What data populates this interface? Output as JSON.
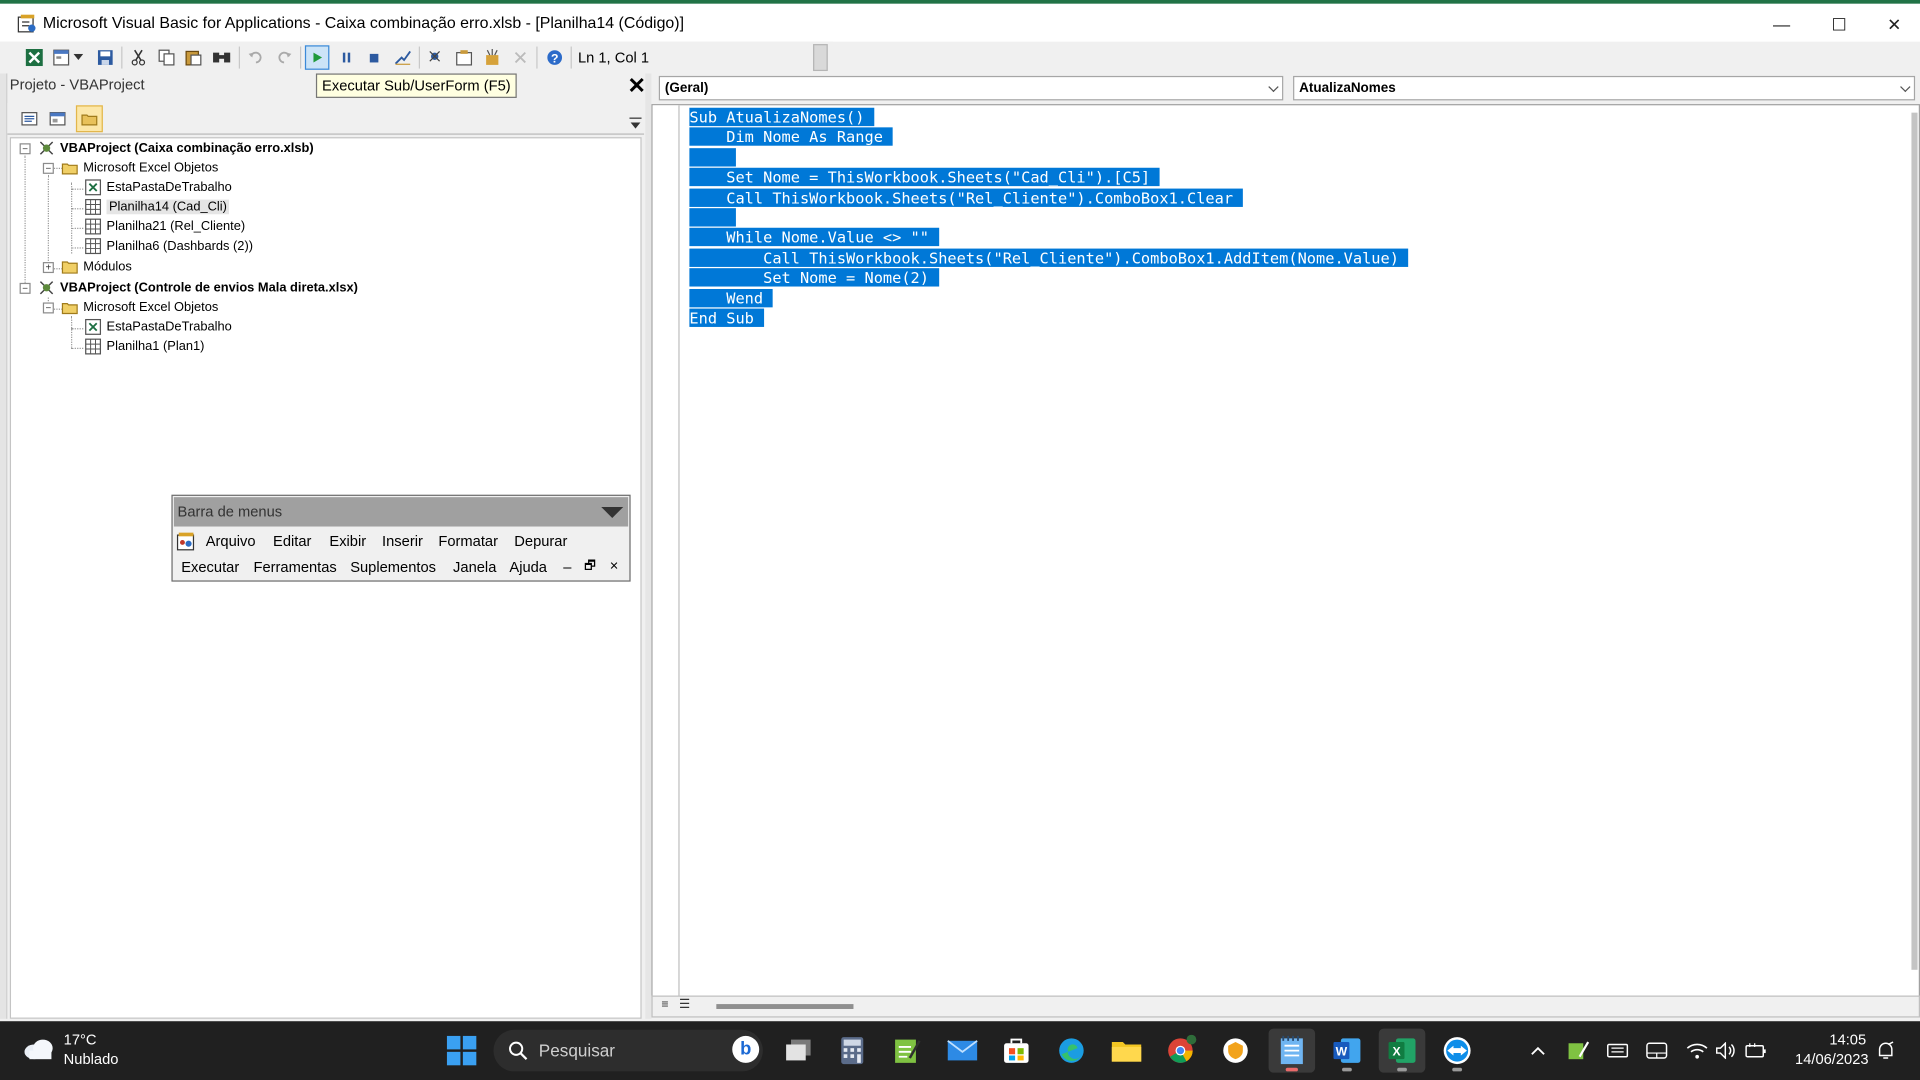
{
  "window": {
    "title": "Microsoft Visual Basic for Applications - Caixa combinação erro.xlsb - [Planilha14 (Código)]",
    "minimize": "—",
    "maximize": "☐",
    "close": "✕"
  },
  "toolbar": {
    "position": "Ln 1, Col 1",
    "tooltip": "Executar Sub/UserForm (F5)"
  },
  "project": {
    "title": "Projeto - VBAProject",
    "close": "✕",
    "tree": [
      {
        "label": "VBAProject (Caixa combinação erro.xlsb)"
      },
      {
        "label": "Microsoft Excel Objetos"
      },
      {
        "label": "EstaPastaDeTrabalho"
      },
      {
        "label": "Planilha14 (Cad_Cli)"
      },
      {
        "label": "Planilha21 (Rel_Cliente)"
      },
      {
        "label": "Planilha6 (Dashbards (2))"
      },
      {
        "label": "Módulos"
      },
      {
        "label": "VBAProject (Controle de envios Mala direta.xlsx)"
      },
      {
        "label": "Microsoft Excel Objetos"
      },
      {
        "label": "EstaPastaDeTrabalho"
      },
      {
        "label": "Planilha1 (Plan1)"
      }
    ]
  },
  "menubar": {
    "title": "Barra de menus",
    "row1": [
      "Arquivo",
      "Editar",
      "Exibir",
      "Inserir",
      "Formatar",
      "Depurar"
    ],
    "row2": [
      "Executar",
      "Ferramentas",
      "Suplementos",
      "Janela",
      "Ajuda"
    ],
    "controls": [
      "–",
      "🗗",
      "×"
    ]
  },
  "code": {
    "object_combo": "(Geral)",
    "procedure_combo": "AtualizaNomes",
    "lines": [
      "Sub AtualizaNomes()",
      "    Dim Nome As Range",
      "",
      "    Set Nome = ThisWorkbook.Sheets(\"Cad_Cli\").[C5]",
      "    Call ThisWorkbook.Sheets(\"Rel_Cliente\").ComboBox1.Clear",
      "",
      "    While Nome.Value <> \"\"",
      "        Call ThisWorkbook.Sheets(\"Rel_Cliente\").ComboBox1.AddItem(Nome.Value)",
      "        Set Nome = Nome(2)",
      "    Wend",
      "End Sub"
    ],
    "selection_color": "#0078d7"
  },
  "taskbar": {
    "temperature": "17°C",
    "weather": "Nublado",
    "search_placeholder": "Pesquisar",
    "bing": "b",
    "time": "14:05",
    "date": "14/06/2023"
  }
}
